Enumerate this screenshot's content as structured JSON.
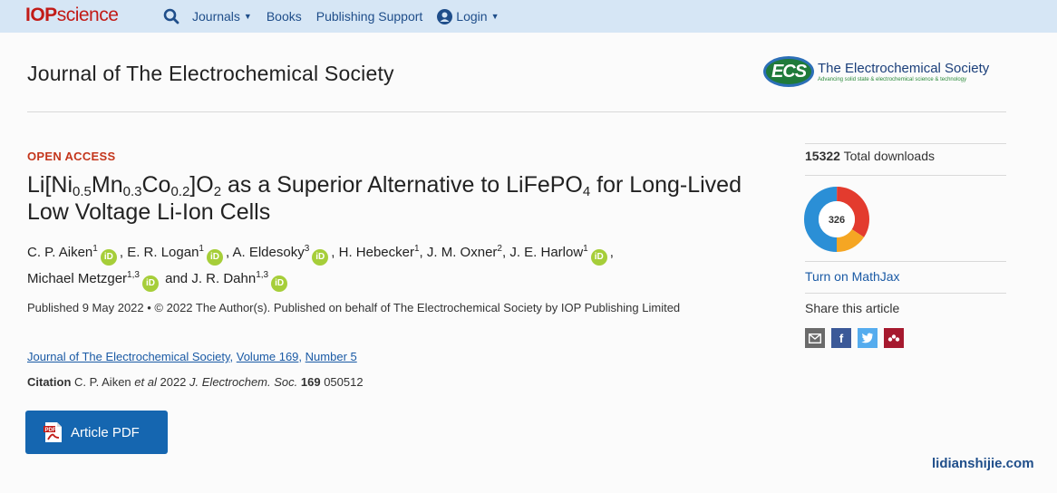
{
  "brand": {
    "part1": "IOP",
    "part2": "science"
  },
  "nav": {
    "journals": "Journals",
    "books": "Books",
    "publishing_support": "Publishing Support",
    "login": "Login"
  },
  "journal": {
    "title": "Journal of The Electrochemical Society",
    "logo_badge": "ECS",
    "logo_name": "The Electrochemical Society",
    "logo_tagline": "Advancing solid state & electrochemical science & technology"
  },
  "article": {
    "access": "OPEN ACCESS",
    "title_parts": {
      "t1": "Li[Ni",
      "s1": "0.5",
      "t2": "Mn",
      "s2": "0.3",
      "t3": "Co",
      "s3": "0.2",
      "t4": "]O",
      "s4": "2",
      "t5": " as a Superior Alternative to LiFePO",
      "s5": "4",
      "t6": " for Long-Lived Low Voltage Li-Ion Cells"
    },
    "authors": [
      {
        "name": "C. P. Aiken",
        "aff": "1",
        "orcid": true
      },
      {
        "name": "E. R. Logan",
        "aff": "1",
        "orcid": true
      },
      {
        "name": "A. Eldesoky",
        "aff": "3",
        "orcid": true
      },
      {
        "name": "H. Hebecker",
        "aff": "1",
        "orcid": false
      },
      {
        "name": "J. M. Oxner",
        "aff": "2",
        "orcid": false
      },
      {
        "name": "J. E. Harlow",
        "aff": "1",
        "orcid": true
      },
      {
        "name": "Michael Metzger",
        "aff": "1,3",
        "orcid": true
      },
      {
        "name": "J. R. Dahn",
        "aff": "1,3",
        "orcid": true
      }
    ],
    "orcid_label": "iD",
    "and_word": "and",
    "published": "Published 9 May 2022 • © 2022 The Author(s). Published on behalf of The Electrochemical Society by IOP Publishing Limited",
    "link_journal": "Journal of The Electrochemical Society",
    "link_volume": "Volume 169",
    "link_number": "Number 5",
    "citation_label": "Citation",
    "citation_authors": "C. P. Aiken",
    "citation_etal": "et al",
    "citation_year": "2022",
    "citation_journal": "J. Electrochem. Soc.",
    "citation_volume": "169",
    "citation_article": "050512",
    "pdf_button": "Article PDF"
  },
  "sidebar": {
    "downloads_count": "15322",
    "downloads_label": "Total downloads",
    "altmetric_score": "326",
    "mathjax": "Turn on MathJax",
    "share_label": "Share this article",
    "share_colors": {
      "email": "#6b6b6b",
      "facebook": "#3b5998",
      "twitter": "#55acee",
      "mendeley": "#a6192e"
    }
  },
  "watermark": "lidianshijie.com"
}
